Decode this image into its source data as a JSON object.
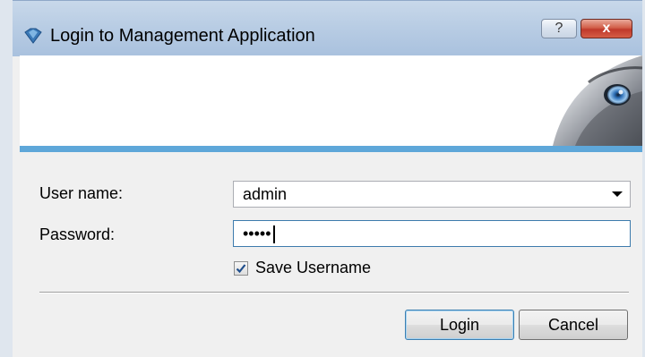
{
  "window": {
    "title": "Login to Management Application",
    "help_label": "?",
    "close_label": "x"
  },
  "form": {
    "username_label": "User name:",
    "username_value": "admin",
    "password_label": "Password:",
    "password_value": "•••••",
    "save_username_label": "Save Username",
    "save_username_checked": true
  },
  "buttons": {
    "login_label": "Login",
    "cancel_label": "Cancel"
  },
  "colors": {
    "title_bar": "#b9cde4",
    "banner_rule": "#5ea7d9",
    "close_button": "#c0392b"
  },
  "icons": {
    "title": "app-diamond-icon",
    "banner": "wolf-eye-logo",
    "dropdown": "chevron-down-icon",
    "checkbox": "checkmark-icon"
  }
}
